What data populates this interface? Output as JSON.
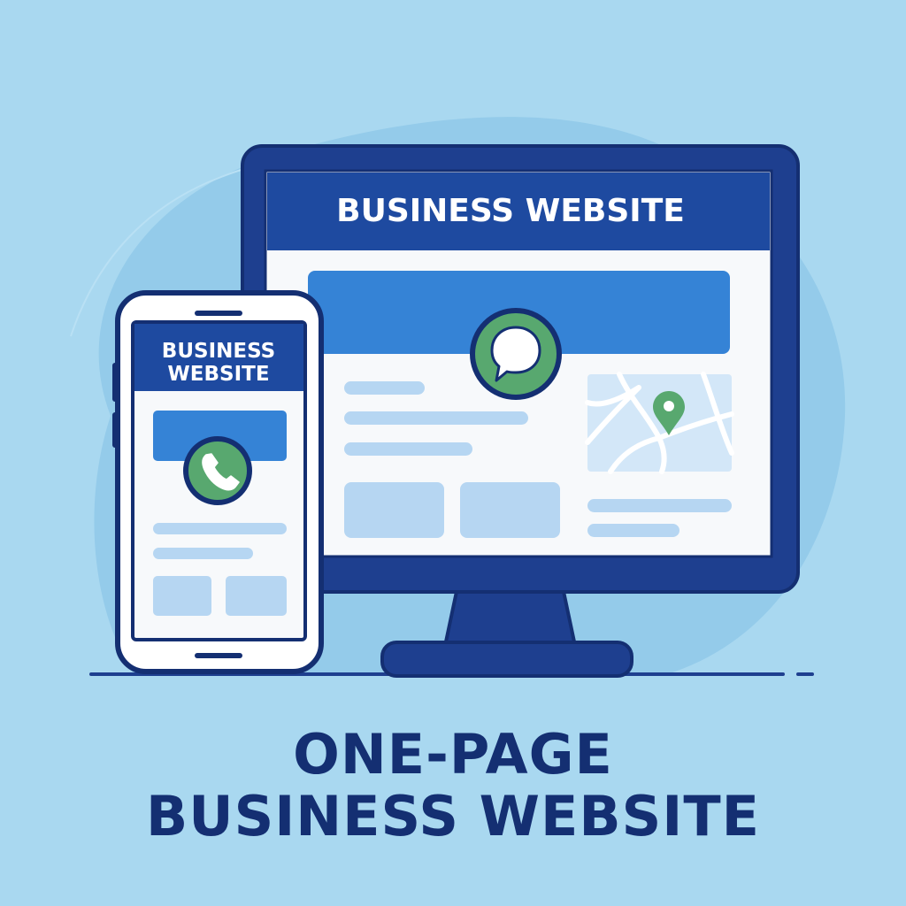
{
  "desktop": {
    "header_title": "BUSINESS WEBSITE",
    "chat_icon": "chat-bubble-icon",
    "map_pin_icon": "map-pin-icon"
  },
  "mobile": {
    "header_title_line_1": "BUSINESS",
    "header_title_line_2": "WEBSITE",
    "phone_icon": "phone-icon"
  },
  "headline": {
    "line_1": "ONE-PAGE",
    "line_2": "BUSINESS WEBSITE"
  },
  "colors": {
    "background": "#a9d8f0",
    "blob": "#94cbea",
    "navy": "#1e3f8f",
    "navy_dark": "#142f72",
    "accent_blue": "#3583d6",
    "placeholder": "#b6d6f2",
    "screen": "#f7f9fb",
    "green": "#58a86f",
    "map": "#d3e7f8"
  }
}
